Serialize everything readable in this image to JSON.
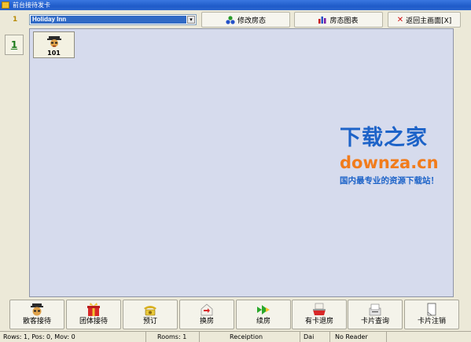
{
  "window": {
    "title": "前台接待发卡"
  },
  "toolbar": {
    "hotel_select": "Holiday Inn",
    "marker": "1",
    "modify_status": "修改房态",
    "status_chart": "房态图表",
    "return_main": "返回主画面[X]"
  },
  "floors": [
    "1"
  ],
  "rooms": [
    {
      "number": "101"
    }
  ],
  "watermark": {
    "title": "下载之家",
    "domain": "downza.cn",
    "slogan": "国内最专业的资源下载站！"
  },
  "bottom_buttons": [
    {
      "label": "散客接待",
      "icon": "guest-icon"
    },
    {
      "label": "团体接待",
      "icon": "gift-icon"
    },
    {
      "label": "预订",
      "icon": "telephone-icon"
    },
    {
      "label": "换房",
      "icon": "swap-room-icon"
    },
    {
      "label": "续房",
      "icon": "arrow-forward-icon"
    },
    {
      "label": "有卡退房",
      "icon": "card-checkout-icon"
    },
    {
      "label": "卡片查询",
      "icon": "card-reader-icon"
    },
    {
      "label": "卡片注销",
      "icon": "card-cancel-icon"
    }
  ],
  "status": {
    "rows": "Rows: 1, Pos: 0, Mov: 0",
    "rooms": "Rooms:  1",
    "module": "Receiption",
    "user": "Dai",
    "reader": "No Reader"
  },
  "colors": {
    "accent": "#316ac5",
    "room_area": "#d6dbed",
    "watermark_blue": "#1d63c8",
    "watermark_orange": "#f17c1c"
  }
}
